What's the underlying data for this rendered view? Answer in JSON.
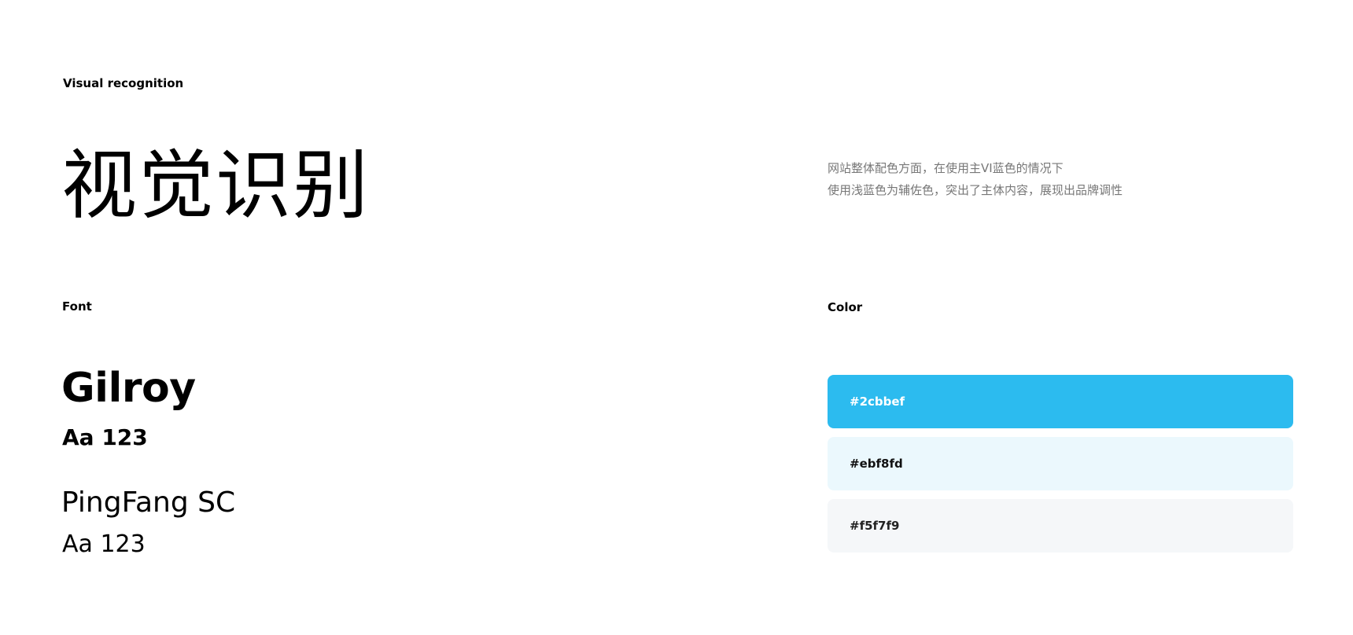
{
  "header": {
    "section_label": "Visual recognition",
    "title": "视觉识别"
  },
  "description": {
    "lines": [
      "网站整体配色方面，在使用主VI蓝色的情况下",
      "使用浅蓝色为辅佐色，突出了主体内容，展现出品牌调性"
    ]
  },
  "font_section": {
    "label": "Font",
    "fonts": [
      {
        "name": "Gilroy",
        "sample": "Aa 123"
      },
      {
        "name": "PingFang SC",
        "sample": "Aa 123"
      }
    ]
  },
  "color_section": {
    "label": "Color",
    "swatches": [
      {
        "hex_label": "#2cbbef",
        "color": "#2cbbef"
      },
      {
        "hex_label": "#ebf8fd",
        "color": "#ebf8fd"
      },
      {
        "hex_label": "#f5f7f9",
        "color": "#f5f7f9"
      }
    ]
  }
}
